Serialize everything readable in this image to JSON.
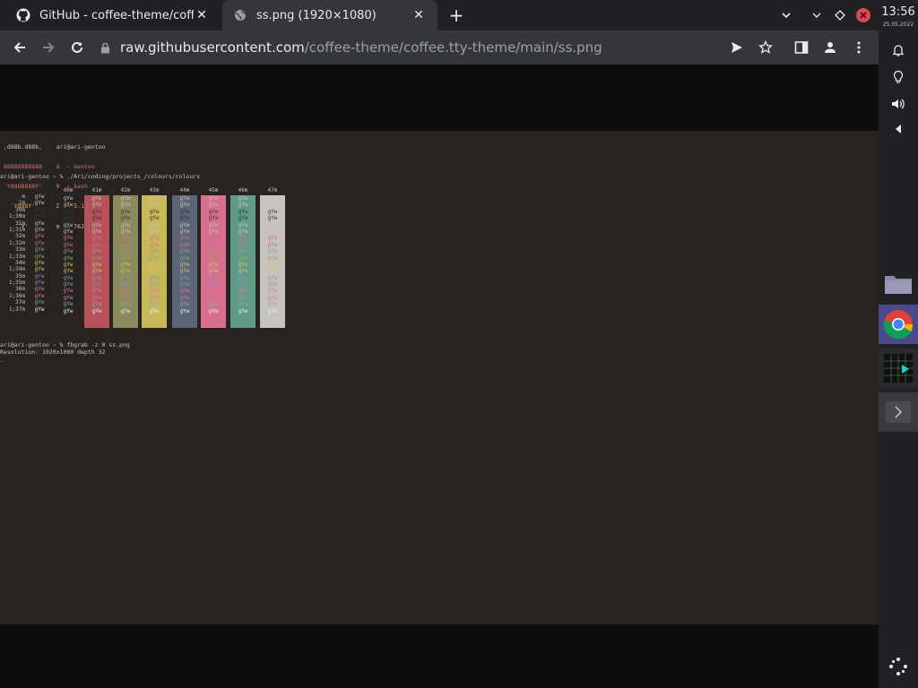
{
  "browser": {
    "tabs": [
      {
        "title": "GitHub - coffee-theme/coffee",
        "icon": "github-icon",
        "active": false
      },
      {
        "title": "ss.png (1920×1080)",
        "icon": "globe-icon",
        "active": true
      }
    ],
    "address": {
      "host": "raw.githubusercontent.com",
      "path": "/coffee-theme/coffee.tty-theme/main/ss.png"
    }
  },
  "terminal": {
    "neofetch": [
      ",d88b.d88b,    ari@ari-gentoo",
      "88888888888    Δ  ~ Gentoo",
      "`Y8888888Y'    Ψ  ~ bash",
      "  `Y888Y'      Σ  ~ 5.16.7",
      "    `Y'        ≡  ~ 76J"
    ],
    "command1": "ari@ari-gentoo ~ % ./Ari/coding/projects_/colours/colours",
    "bg_headers": [
      "40m",
      "41m",
      "42m",
      "43m",
      "44m",
      "45m",
      "46m",
      "47m"
    ],
    "row_labels": [
      "m",
      "1m",
      "30m",
      "1;30m",
      "31m",
      "1;31m",
      "32m",
      "1;32m",
      "33m",
      "1;33m",
      "34m",
      "1;34m",
      "35m",
      "1;35m",
      "36m",
      "1;36m",
      "37m",
      "1;37m"
    ],
    "sample": "gYw",
    "command2": "ari@ari-gentoo ~ % fbgrab -z 0 ss.png",
    "output": "Resolution: 1920x1080 depth 32",
    "cursor": "_"
  },
  "colors": {
    "bg": [
      "#272320",
      "#b5525a",
      "#8a8a5c",
      "#c8b85c",
      "#5c6478",
      "#d86f8f",
      "#5f9b88",
      "#c8c2be"
    ],
    "fg": [
      "#c9c2b8",
      "#c9c2b8",
      "#3a3633",
      "#3a3633",
      "#c9c2b8",
      "#c9c2b8",
      "#d86f8f",
      "#d86f8f",
      "#8fa86a",
      "#8fa86a",
      "#d4c56a",
      "#d4c56a",
      "#8b95b5",
      "#8b95b5",
      "#d67aa0",
      "#d67aa0",
      "#7ab8a5",
      "#f0ece8"
    ]
  },
  "shelf": {
    "time": "13:56",
    "date": "25.05.2022",
    "icons": [
      "bell-icon",
      "lightbulb-icon",
      "volume-icon",
      "caret-left-icon"
    ],
    "apps": [
      "files-app",
      "chrome-app",
      "terminal-app",
      "expand-app"
    ]
  }
}
